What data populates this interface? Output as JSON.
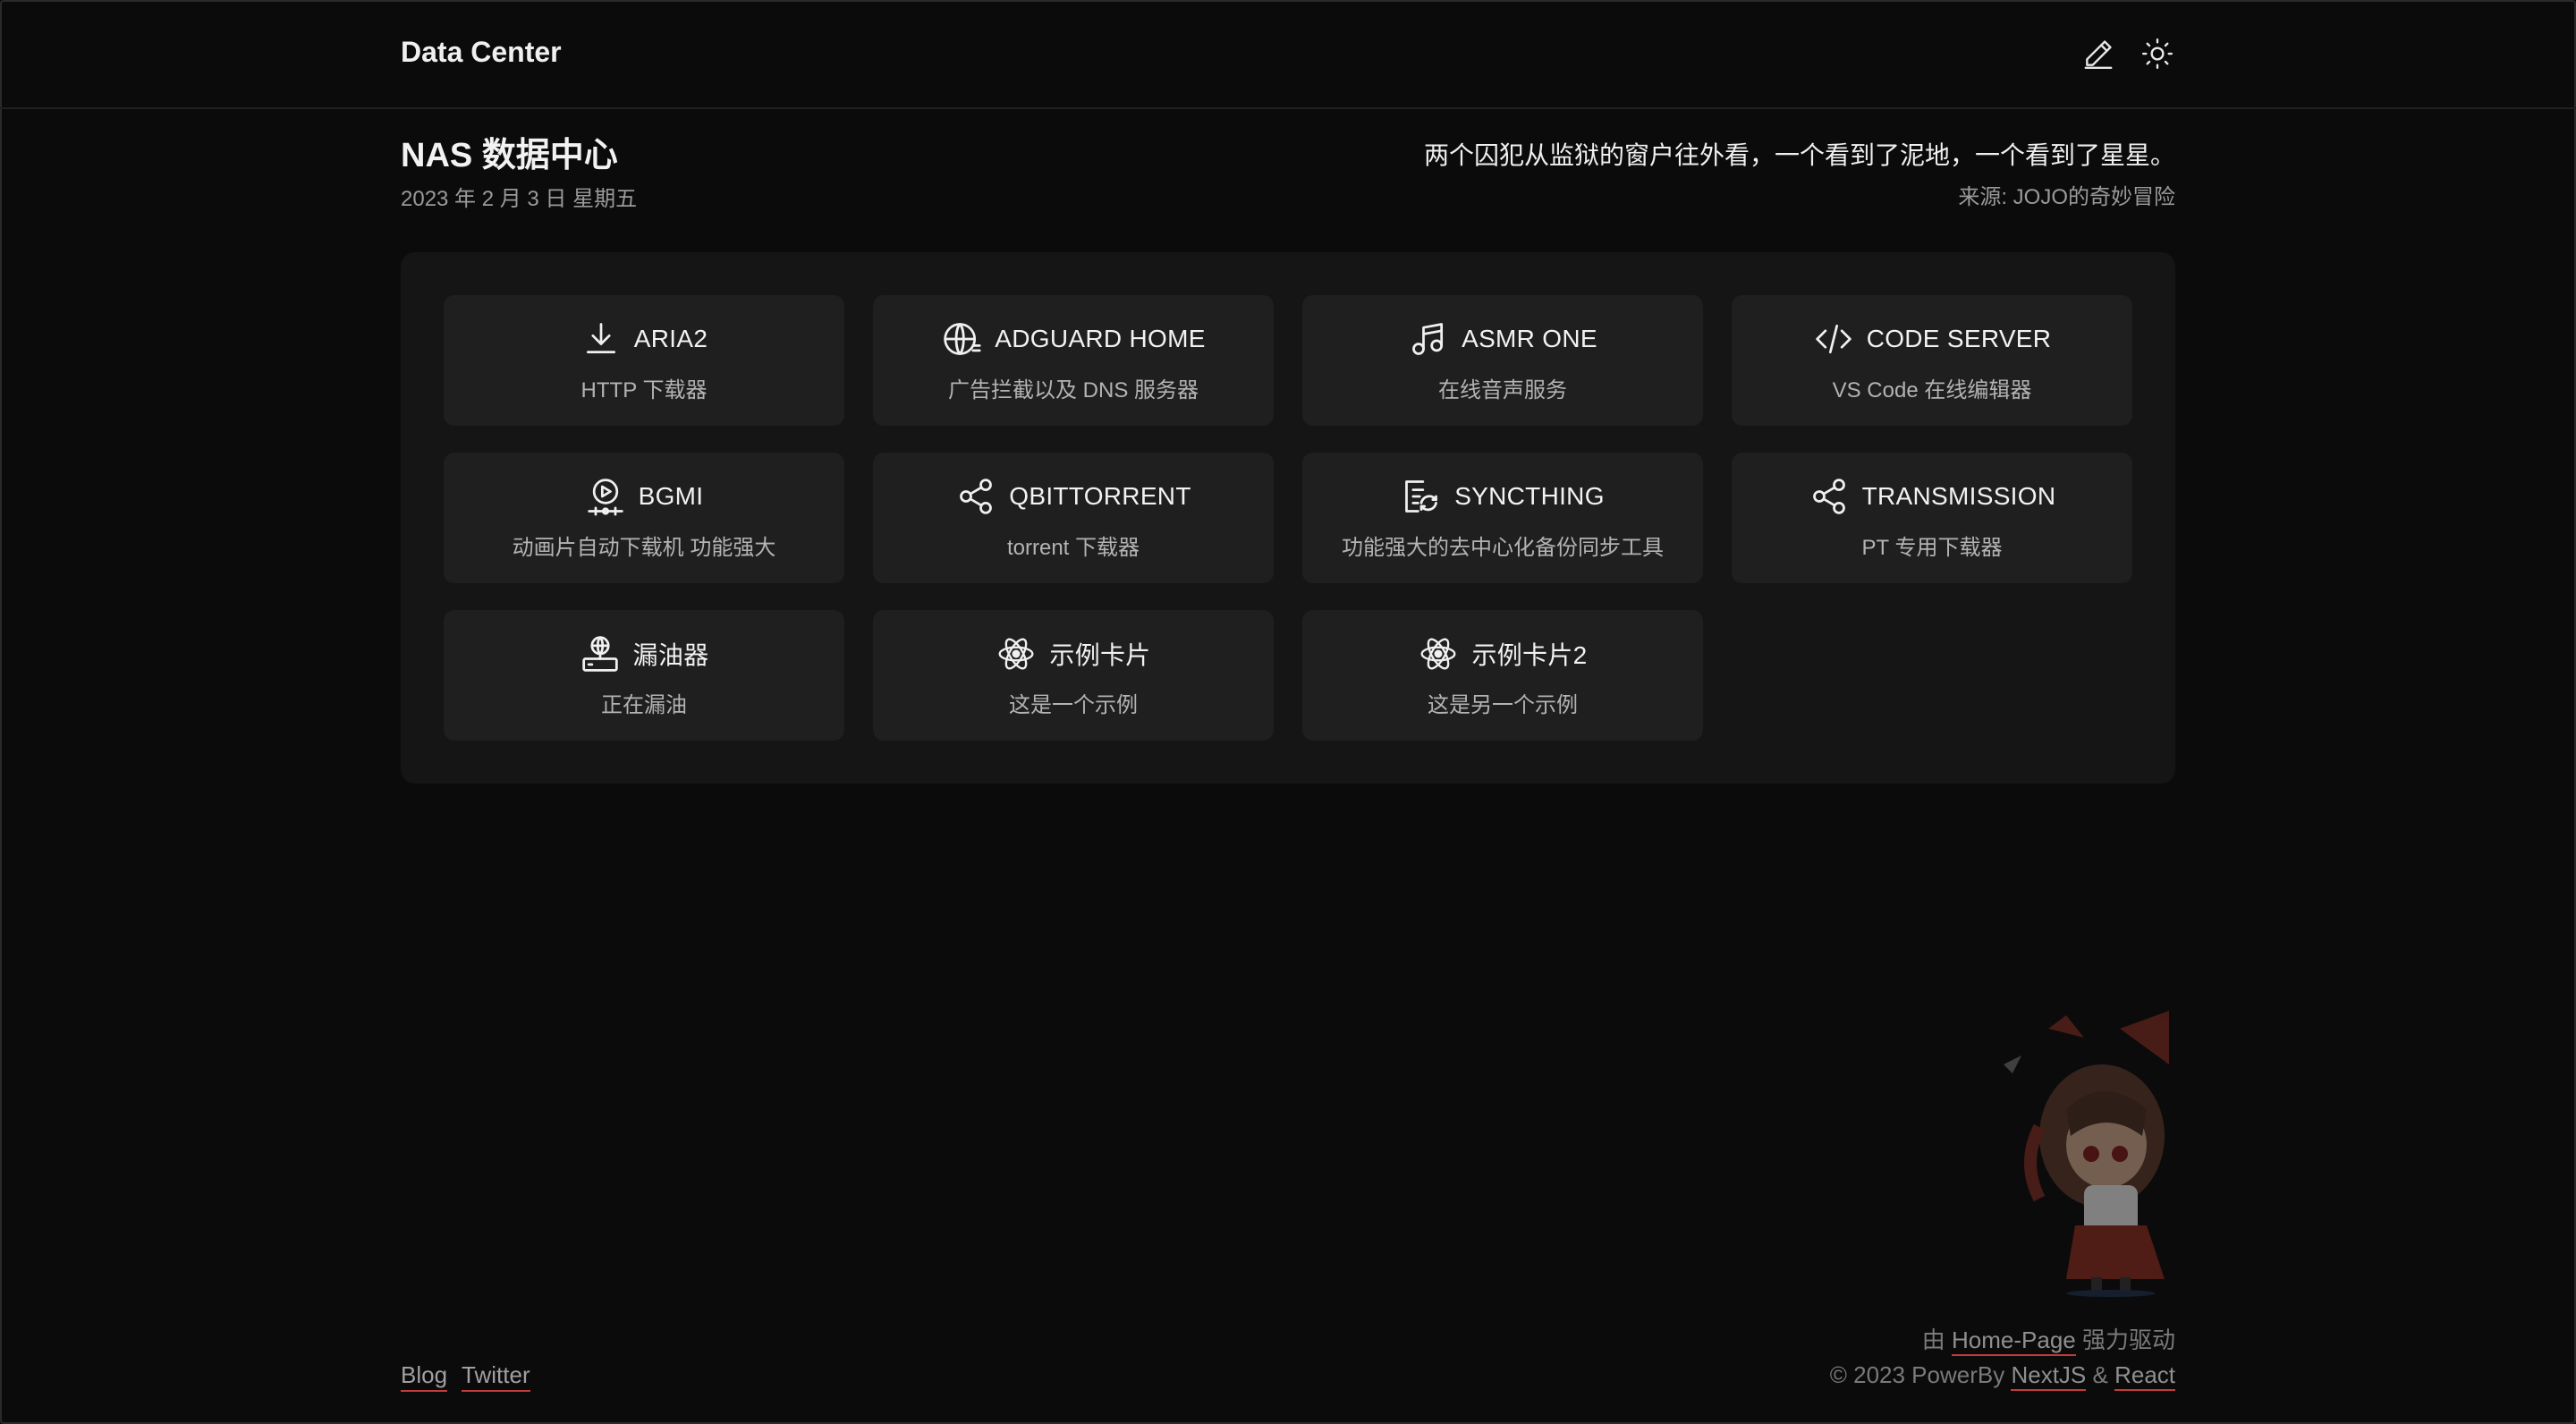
{
  "header": {
    "brand": "Data Center",
    "icons": [
      "edit-icon",
      "sun-icon"
    ]
  },
  "page": {
    "title": "NAS 数据中心",
    "date": "2023 年 2 月 3 日 星期五",
    "quote": "两个囚犯从监狱的窗户往外看，一个看到了泥地，一个看到了星星。",
    "quote_source": "来源: JOJO的奇妙冒险"
  },
  "cards": [
    {
      "title": "ARIA2",
      "desc": "HTTP 下载器",
      "icon": "download-icon"
    },
    {
      "title": "ADGUARD HOME",
      "desc": "广告拦截以及 DNS 服务器",
      "icon": "globe-icon"
    },
    {
      "title": "ASMR ONE",
      "desc": "在线音声服务",
      "icon": "music-icon"
    },
    {
      "title": "CODE SERVER",
      "desc": "VS Code 在线编辑器",
      "icon": "code-icon"
    },
    {
      "title": "BGMI",
      "desc": "动画片自动下载机 功能强大",
      "icon": "play-timeline-icon"
    },
    {
      "title": "QBITTORRENT",
      "desc": "torrent 下载器",
      "icon": "share-icon"
    },
    {
      "title": "SYNCTHING",
      "desc": "功能强大的去中心化备份同步工具",
      "icon": "sync-list-icon"
    },
    {
      "title": "TRANSMISSION",
      "desc": "PT 专用下载器",
      "icon": "share-icon"
    },
    {
      "title": "漏油器",
      "desc": "正在漏油",
      "icon": "globe-server-icon"
    },
    {
      "title": "示例卡片",
      "desc": "这是一个示例",
      "icon": "react-icon"
    },
    {
      "title": "示例卡片2",
      "desc": "这是另一个示例",
      "icon": "react-icon"
    }
  ],
  "footer": {
    "links": [
      "Blog",
      "Twitter"
    ],
    "powered_prefix": "由",
    "powered_link": "Home-Page",
    "powered_suffix": "强力驱动",
    "copyright": "© 2023 PowerBy",
    "tech_1": "NextJS",
    "amp": "&",
    "tech_2": "React"
  }
}
